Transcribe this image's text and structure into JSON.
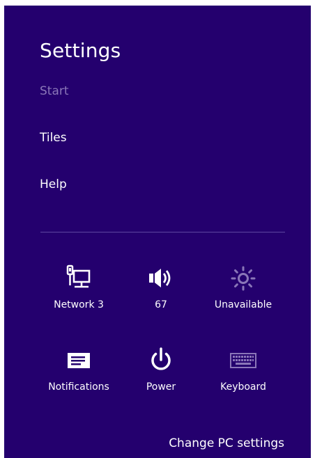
{
  "settings": {
    "title": "Settings",
    "menu": [
      {
        "label": "Start",
        "enabled": false
      },
      {
        "label": "Tiles",
        "enabled": true
      },
      {
        "label": "Help",
        "enabled": true
      }
    ],
    "quick_settings": [
      {
        "icon": "network-wired-icon",
        "label": "Network  3"
      },
      {
        "icon": "volume-icon",
        "label": "67"
      },
      {
        "icon": "brightness-icon",
        "label": "Unavailable",
        "enabled": false
      },
      {
        "icon": "notifications-icon",
        "label": "Notifications"
      },
      {
        "icon": "power-icon",
        "label": "Power"
      },
      {
        "icon": "keyboard-icon",
        "label": "Keyboard",
        "enabled": false
      }
    ],
    "change_pc_settings": "Change PC settings"
  },
  "colors": {
    "background": "#24006e",
    "text": "#ffffff",
    "disabled_text": "#8a76b8",
    "divider": "#5e48a0"
  }
}
